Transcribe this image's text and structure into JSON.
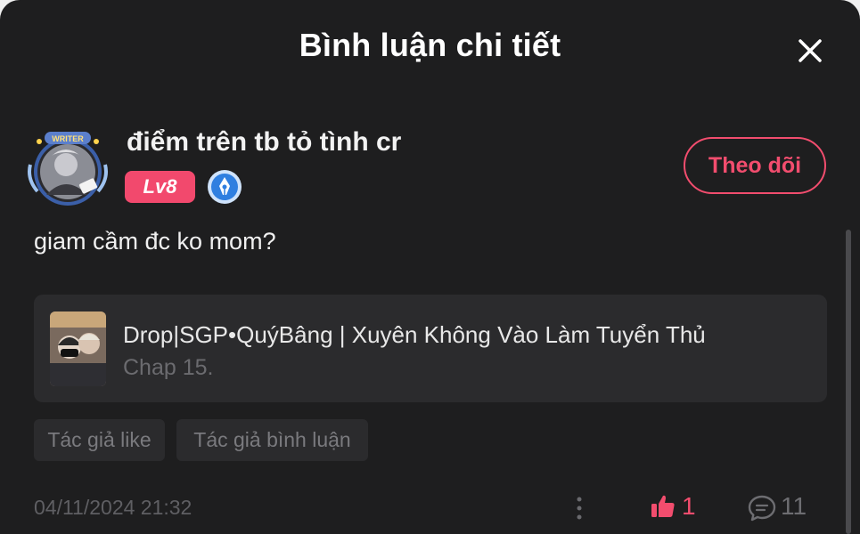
{
  "header": {
    "title": "Bình luận chi tiết"
  },
  "user": {
    "name": "điểm trên tb tỏ tình cr",
    "level": "Lv8",
    "avatar_frame_text": "WRITER",
    "follow_label": "Theo dõi"
  },
  "comment": {
    "text": "giam cầm đc ko mom?"
  },
  "story": {
    "title": "Drop|SGP•QuýBâng | Xuyên Không Vào Làm Tuyển Thủ",
    "chapter": "Chap 15."
  },
  "tags": [
    {
      "label": "Tác giả like"
    },
    {
      "label": "Tác giả bình luận"
    }
  ],
  "footer": {
    "timestamp": "04/11/2024 21:32",
    "like_count": "1",
    "reply_count": "11"
  },
  "colors": {
    "accent": "#f24d6e",
    "background": "#1e1e1f",
    "card": "#2b2b2d",
    "badge_blue": "#2f7fe0"
  },
  "icons": [
    "close-icon",
    "writer-pen-icon",
    "more-vertical-icon",
    "thumbs-up-icon",
    "comment-bubble-icon"
  ]
}
